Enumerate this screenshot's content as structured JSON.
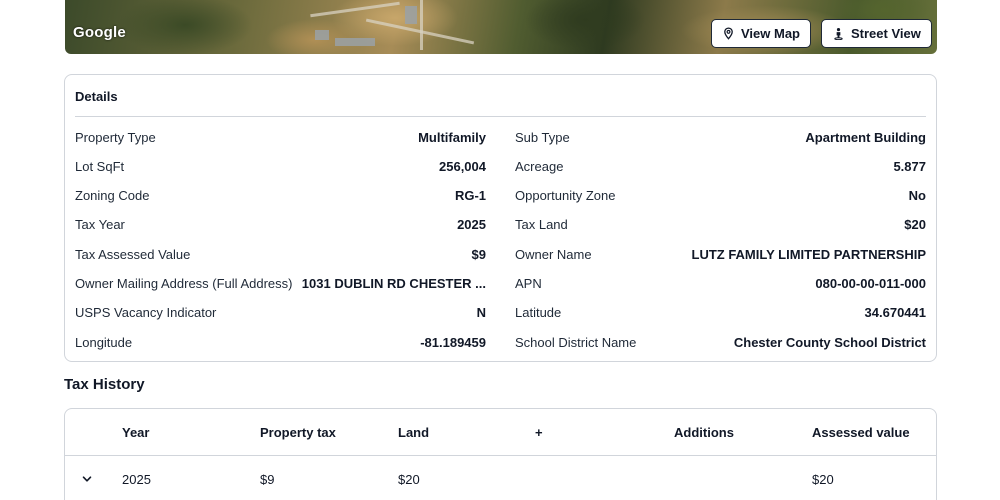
{
  "map": {
    "logo": "Google",
    "view_map_label": "View Map",
    "street_view_label": "Street View"
  },
  "details": {
    "title": "Details",
    "left": [
      {
        "label": "Property Type",
        "value": "Multifamily"
      },
      {
        "label": "Lot SqFt",
        "value": "256,004"
      },
      {
        "label": "Zoning Code",
        "value": "RG-1"
      },
      {
        "label": "Tax Year",
        "value": "2025"
      },
      {
        "label": "Tax Assessed Value",
        "value": "$9"
      },
      {
        "label": "Owner Mailing Address (Full Address)",
        "value": "1031 DUBLIN RD CHESTER ..."
      },
      {
        "label": "USPS Vacancy Indicator",
        "value": "N"
      },
      {
        "label": "Longitude",
        "value": "-81.189459"
      }
    ],
    "right": [
      {
        "label": "Sub Type",
        "value": "Apartment Building"
      },
      {
        "label": "Acreage",
        "value": "5.877"
      },
      {
        "label": "Opportunity Zone",
        "value": "No"
      },
      {
        "label": "Tax Land",
        "value": "$20"
      },
      {
        "label": "Owner Name",
        "value": "LUTZ FAMILY LIMITED PARTNERSHIP"
      },
      {
        "label": "APN",
        "value": "080-00-00-011-000"
      },
      {
        "label": "Latitude",
        "value": "34.670441"
      },
      {
        "label": "School District Name",
        "value": "Chester County School District"
      }
    ]
  },
  "tax_history": {
    "title": "Tax History",
    "columns": [
      "Year",
      "Property tax",
      "Land",
      "+",
      "Additions",
      "Assessed value"
    ],
    "rows": [
      {
        "year": "2025",
        "property_tax": "$9",
        "land": "$20",
        "plus": "",
        "additions": "",
        "assessed_value": "$20"
      }
    ]
  }
}
